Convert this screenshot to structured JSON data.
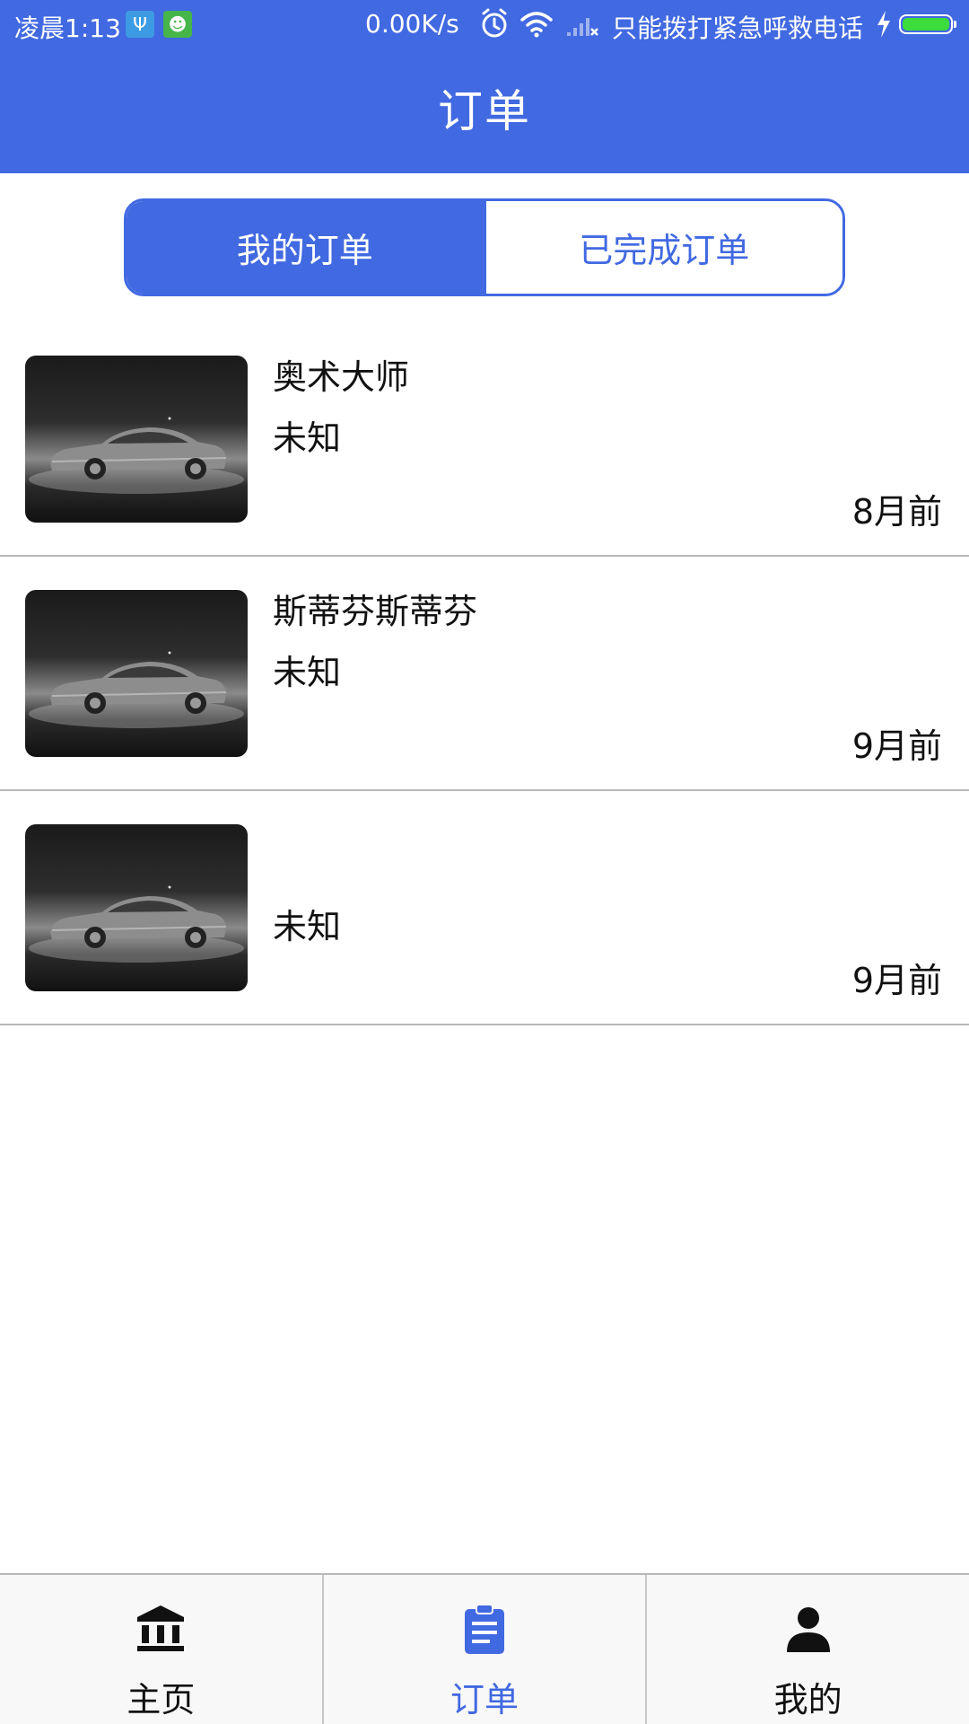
{
  "status_bar": {
    "time": "凌晨1:13",
    "usb_badge": "Ψ",
    "android_badge": "☻",
    "network_speed": "0.00K/s",
    "carrier_text": "只能拨打紧急呼救电话",
    "icons": [
      "usb-icon",
      "android-debug-icon",
      "alarm-icon",
      "wifi-icon",
      "signal-icon",
      "charging-icon",
      "battery-icon"
    ],
    "battery_level": 1.0
  },
  "header": {
    "title": "订单"
  },
  "segment": {
    "tabs": [
      {
        "label": "我的订单",
        "active": true
      },
      {
        "label": "已完成订单",
        "active": false
      }
    ]
  },
  "orders": [
    {
      "name": "奥术大师",
      "status": "未知",
      "time_ago": "8月前",
      "image": "car-thumbnail"
    },
    {
      "name": "斯蒂芬斯蒂芬",
      "status": "未知",
      "time_ago": "9月前",
      "image": "car-thumbnail"
    },
    {
      "name": "",
      "status": "未知",
      "time_ago": "9月前",
      "image": "car-thumbnail"
    }
  ],
  "bottom_nav": {
    "items": [
      {
        "label": "主页",
        "icon": "bank-icon",
        "active": false
      },
      {
        "label": "订单",
        "icon": "clipboard-icon",
        "active": true
      },
      {
        "label": "我的",
        "icon": "person-icon",
        "active": false
      }
    ]
  },
  "colors": {
    "primary": "#4169e1",
    "text": "#111111",
    "divider": "#b8b8b8",
    "nav_background": "#f8f8f8",
    "battery": "#3ddc3d"
  }
}
